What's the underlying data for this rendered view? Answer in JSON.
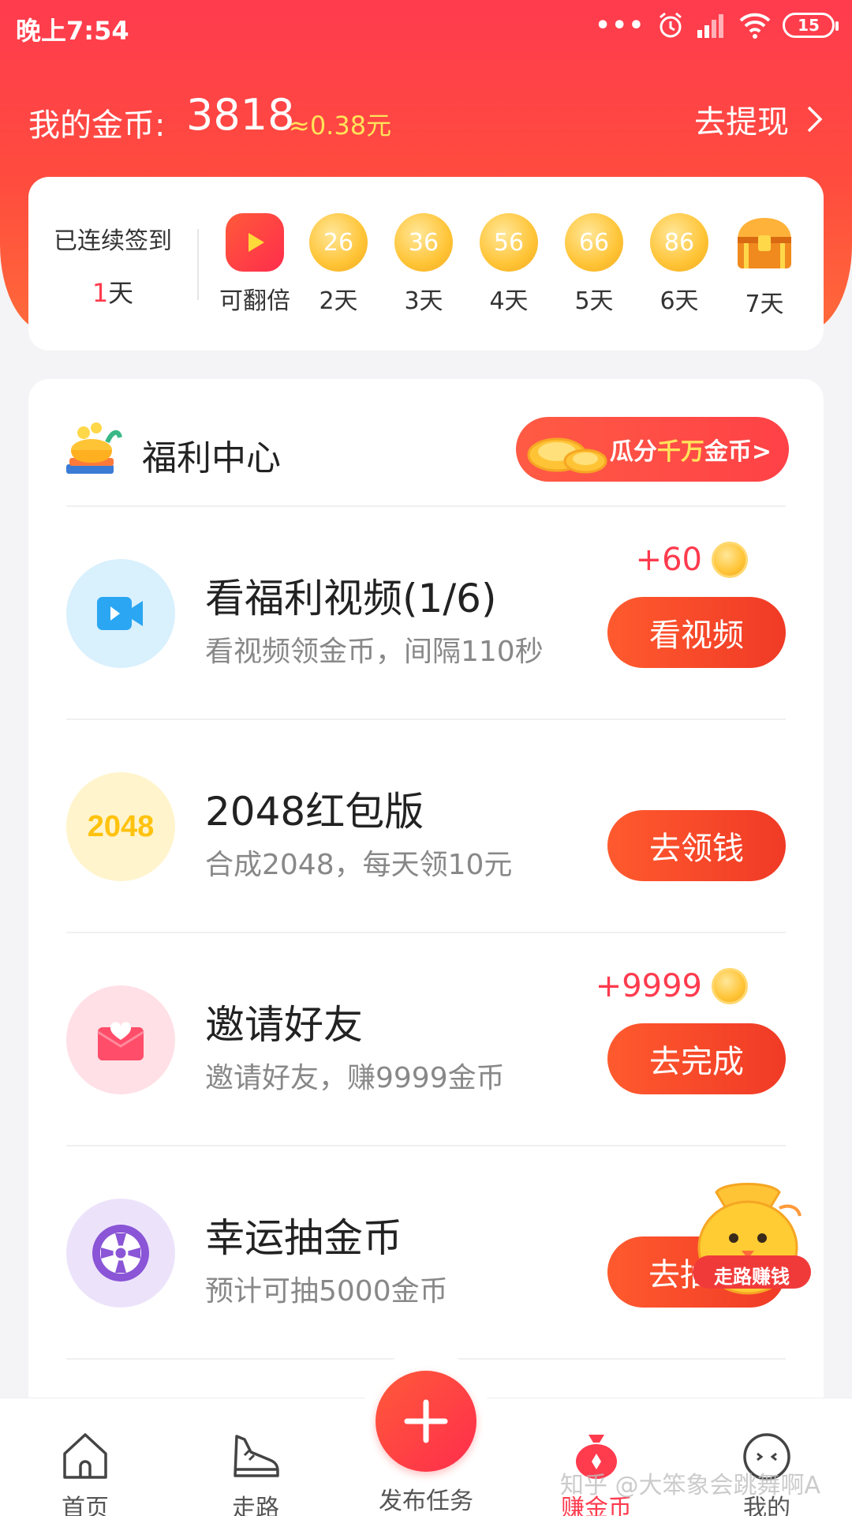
{
  "status_bar": {
    "time": "晚上7:54",
    "battery": "15",
    "dots": "•••"
  },
  "header": {
    "coin_label": "我的金币:",
    "coin_value": "3818",
    "coin_yuan": "≈0.38元",
    "withdraw_label": "去提现"
  },
  "signin": {
    "title": "已连续签到",
    "days_num": "1",
    "days_unit": "天",
    "days": [
      {
        "coin": "",
        "label": "可翻倍"
      },
      {
        "coin": "26",
        "label": "2天"
      },
      {
        "coin": "36",
        "label": "3天"
      },
      {
        "coin": "56",
        "label": "4天"
      },
      {
        "coin": "66",
        "label": "5天"
      },
      {
        "coin": "86",
        "label": "6天"
      },
      {
        "coin": "",
        "label": "7天"
      }
    ]
  },
  "welfare": {
    "title": "福利中心",
    "share_prefix": "瓜分",
    "share_highlight": "千万",
    "share_suffix": "金币>"
  },
  "tasks": [
    {
      "title": "看福利视频(1/6)",
      "desc": "看视频领金币，间隔110秒",
      "reward": "+60",
      "button": "看视频",
      "icon": "video-icon"
    },
    {
      "title": "2048红包版",
      "desc": "合成2048，每天领10元",
      "reward": "",
      "button": "去领钱",
      "icon": "2048-icon",
      "icon_text": "2048"
    },
    {
      "title": "邀请好友",
      "desc": "邀请好友，赚9999金币",
      "reward": "+9999",
      "button": "去完成",
      "icon": "envelope-heart-icon"
    },
    {
      "title": "幸运抽金币",
      "desc": "预计可抽5000金币",
      "reward": "",
      "button": "去抽",
      "icon": "wheel-icon"
    }
  ],
  "mascot": {
    "label": "走路赚钱"
  },
  "tabbar": {
    "items": [
      {
        "label": "首页",
        "icon": "home-icon"
      },
      {
        "label": "走路",
        "icon": "shoe-icon"
      },
      {
        "label": "发布任务",
        "icon": "plus-icon"
      },
      {
        "label": "赚金币",
        "icon": "money-bag-icon"
      },
      {
        "label": "我的",
        "icon": "face-icon"
      }
    ]
  },
  "watermark": "知乎 @大笨象会跳舞啊A",
  "colors": {
    "brand": "#ff3b4e",
    "accent": "#ffe35a",
    "button": "#f03a26"
  }
}
